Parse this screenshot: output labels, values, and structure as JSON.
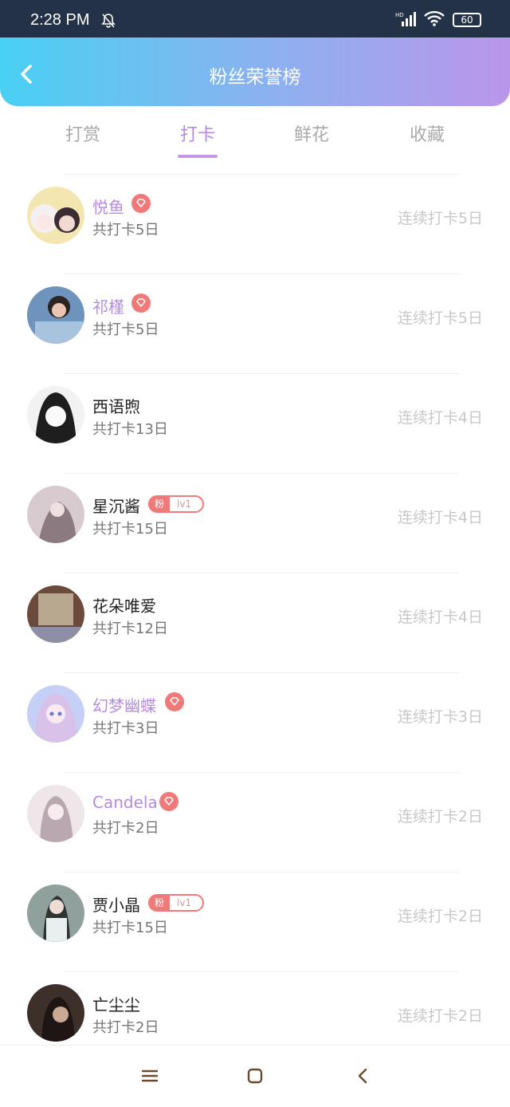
{
  "status": {
    "time": "2:28 PM",
    "battery": "60"
  },
  "header": {
    "title": "粉丝荣誉榜"
  },
  "tabs": [
    {
      "label": "打赏"
    },
    {
      "label": "打卡"
    },
    {
      "label": "鲜花"
    },
    {
      "label": "收藏"
    }
  ],
  "active_tab": "打卡",
  "list": [
    {
      "name": "悦鱼",
      "total": "共打卡5日",
      "streak": "连续打卡5日",
      "badge": "diamond",
      "avatar_color": "#f3e6b0"
    },
    {
      "name": "祁槿",
      "total": "共打卡5日",
      "streak": "连续打卡5日",
      "badge": "diamond",
      "avatar_color": "#7fa7cf"
    },
    {
      "name": "西语煦",
      "total": "共打卡13日",
      "streak": "连续打卡4日",
      "badge": "none",
      "avatar_color": "#bdbdbd"
    },
    {
      "name": "星沉酱",
      "total": "共打卡15日",
      "streak": "连续打卡4日",
      "badge": "fan",
      "fan_label": "粉",
      "fan_level": "lv1",
      "avatar_color": "#c9b8bf"
    },
    {
      "name": "花朵唯爱",
      "total": "共打卡12日",
      "streak": "连续打卡4日",
      "badge": "none",
      "avatar_color": "#8a6a5a"
    },
    {
      "name": "幻梦幽蝶",
      "total": "共打卡3日",
      "streak": "连续打卡3日",
      "badge": "diamond",
      "avatar_color": "#b9c4f0"
    },
    {
      "name": "Candela",
      "total": "共打卡2日",
      "streak": "连续打卡2日",
      "badge": "diamond",
      "avatar_color": "#e8dde3"
    },
    {
      "name": "贾小晶",
      "total": "共打卡15日",
      "streak": "连续打卡2日",
      "badge": "fan",
      "fan_label": "粉",
      "fan_level": "lv1",
      "avatar_color": "#7a8a88"
    },
    {
      "name": "亡尘尘",
      "total": "共打卡2日",
      "streak": "连续打卡2日",
      "badge": "none",
      "avatar_color": "#5a4a44"
    }
  ],
  "colors": {
    "accent": "#b58be0",
    "header_start": "#49d0f3",
    "header_end": "#ba96ea",
    "badge_red": "#f07a7a"
  }
}
